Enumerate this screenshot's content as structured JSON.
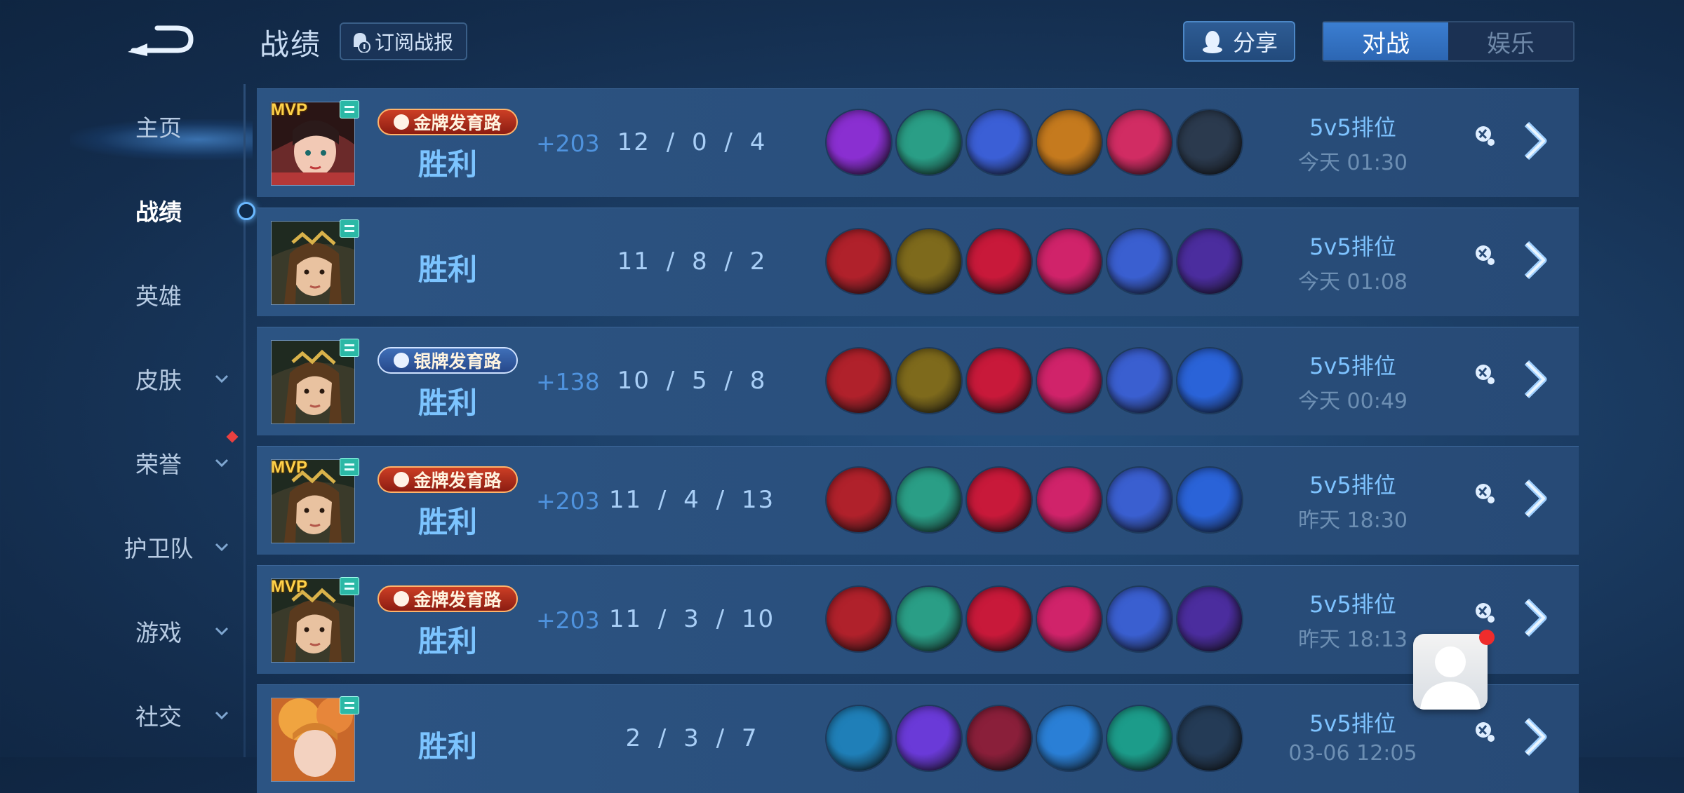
{
  "header": {
    "title": "战绩",
    "subscribe_label": "订阅战报",
    "share_label": "分享",
    "tabs": [
      {
        "label": "对战",
        "active": true
      },
      {
        "label": "娱乐",
        "active": false
      }
    ]
  },
  "sidebar": {
    "items": [
      {
        "label": "主页",
        "active": false,
        "expandable": false
      },
      {
        "label": "战绩",
        "active": true,
        "expandable": false
      },
      {
        "label": "英雄",
        "active": false,
        "expandable": false
      },
      {
        "label": "皮肤",
        "active": false,
        "expandable": true
      },
      {
        "label": "荣誉",
        "active": false,
        "expandable": true,
        "has_notification": true
      },
      {
        "label": "护卫队",
        "active": false,
        "expandable": true
      },
      {
        "label": "游戏",
        "active": false,
        "expandable": true
      },
      {
        "label": "社交",
        "active": false,
        "expandable": true
      }
    ]
  },
  "matches": [
    {
      "mvp": true,
      "mvp_label": "MVP",
      "badge": "金牌发育路",
      "badge_type": "gold",
      "result": "胜利",
      "score": "+203",
      "kda": "12 / 0 / 4",
      "mode": "5v5排位",
      "time": "今天 01:30",
      "hero": "hero-a",
      "items": [
        "#8a2fd1",
        "#2a9e86",
        "#3b5fd6",
        "#c57a1e",
        "#d12c63",
        "#2b3a4e"
      ]
    },
    {
      "mvp": false,
      "mvp_label": "",
      "badge": "",
      "badge_type": "",
      "result": "胜利",
      "score": "",
      "kda": "11 / 8 / 2",
      "mode": "5v5排位",
      "time": "今天 01:08",
      "hero": "hero-b",
      "items": [
        "#b0212b",
        "#7e6a1c",
        "#c8193a",
        "#d0236a",
        "#3a5fd0",
        "#4b2d9e"
      ]
    },
    {
      "mvp": false,
      "mvp_label": "",
      "badge": "银牌发育路",
      "badge_type": "silver",
      "result": "胜利",
      "score": "+138",
      "kda": "10 / 5 / 8",
      "mode": "5v5排位",
      "time": "今天 00:49",
      "hero": "hero-b",
      "items": [
        "#b0212b",
        "#7e6a1c",
        "#c8193a",
        "#d0236a",
        "#3a5fd0",
        "#2a63d8"
      ]
    },
    {
      "mvp": true,
      "mvp_label": "MVP",
      "badge": "金牌发育路",
      "badge_type": "gold",
      "result": "胜利",
      "score": "+203",
      "kda": "11 / 4 / 13",
      "mode": "5v5排位",
      "time": "昨天 18:30",
      "hero": "hero-b",
      "items": [
        "#b0212b",
        "#2a9e86",
        "#c8193a",
        "#d0236a",
        "#3a5fd0",
        "#2a63d8"
      ]
    },
    {
      "mvp": true,
      "mvp_label": "MVP",
      "badge": "金牌发育路",
      "badge_type": "gold",
      "result": "胜利",
      "score": "+203",
      "kda": "11 / 3 / 10",
      "mode": "5v5排位",
      "time": "昨天 18:13",
      "hero": "hero-b",
      "items": [
        "#b0212b",
        "#2a9e86",
        "#c8193a",
        "#d0236a",
        "#3a5fd0",
        "#4b2d9e"
      ]
    },
    {
      "mvp": false,
      "mvp_label": "",
      "badge": "",
      "badge_type": "",
      "result": "胜利",
      "score": "",
      "kda": "2 / 3 / 7",
      "mode": "5v5排位",
      "time": "03-06 12:05",
      "hero": "hero-c",
      "items": [
        "#1f7fb8",
        "#6a3ad8",
        "#8a1f3a",
        "#2a7fd6",
        "#1c9c8a",
        "#243b56"
      ]
    }
  ]
}
